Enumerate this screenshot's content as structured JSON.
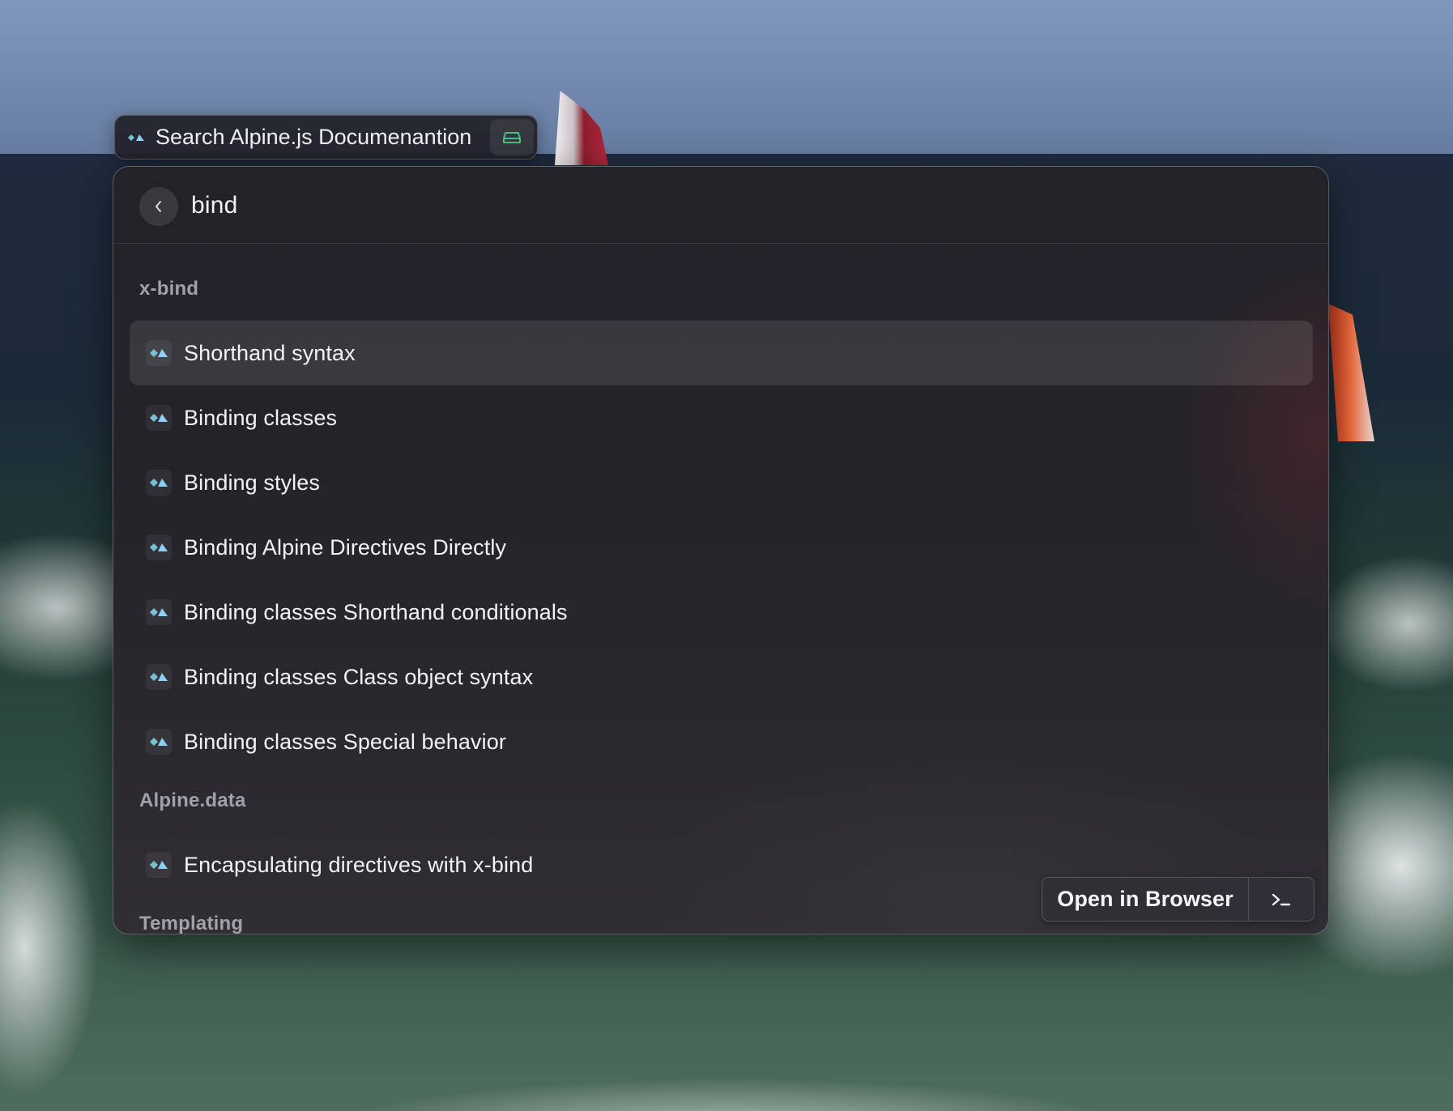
{
  "search_pill": {
    "label": "Search Alpine.js Documenantion",
    "logo_icon": "alpine-logo-icon",
    "action_icon": "storage-icon",
    "action_icon_color": "#47c07e"
  },
  "search": {
    "query": "bind",
    "back_icon": "chevron-left-icon"
  },
  "results": {
    "sections": [
      {
        "title": "x-bind",
        "items": [
          {
            "label": "Shorthand syntax",
            "selected": true
          },
          {
            "label": "Binding classes"
          },
          {
            "label": "Binding styles"
          },
          {
            "label": "Binding Alpine Directives Directly"
          },
          {
            "label": "Binding classes Shorthand conditionals"
          },
          {
            "label": "Binding classes Class object syntax"
          },
          {
            "label": "Binding classes Special behavior"
          }
        ]
      },
      {
        "title": "Alpine.data",
        "items": [
          {
            "label": "Encapsulating directives with x-bind"
          }
        ]
      },
      {
        "title": "Templating",
        "items": []
      }
    ],
    "item_icon": "alpine-logo-icon"
  },
  "action_bar": {
    "primary_label": "Open in Browser",
    "secondary_icon": "terminal-icon"
  },
  "colors": {
    "alpine_light": "#8fd0f2",
    "alpine_dark": "#77c1d2",
    "panel_bg": "#24232a",
    "selected_row": "rgba(255,255,255,0.10)"
  }
}
